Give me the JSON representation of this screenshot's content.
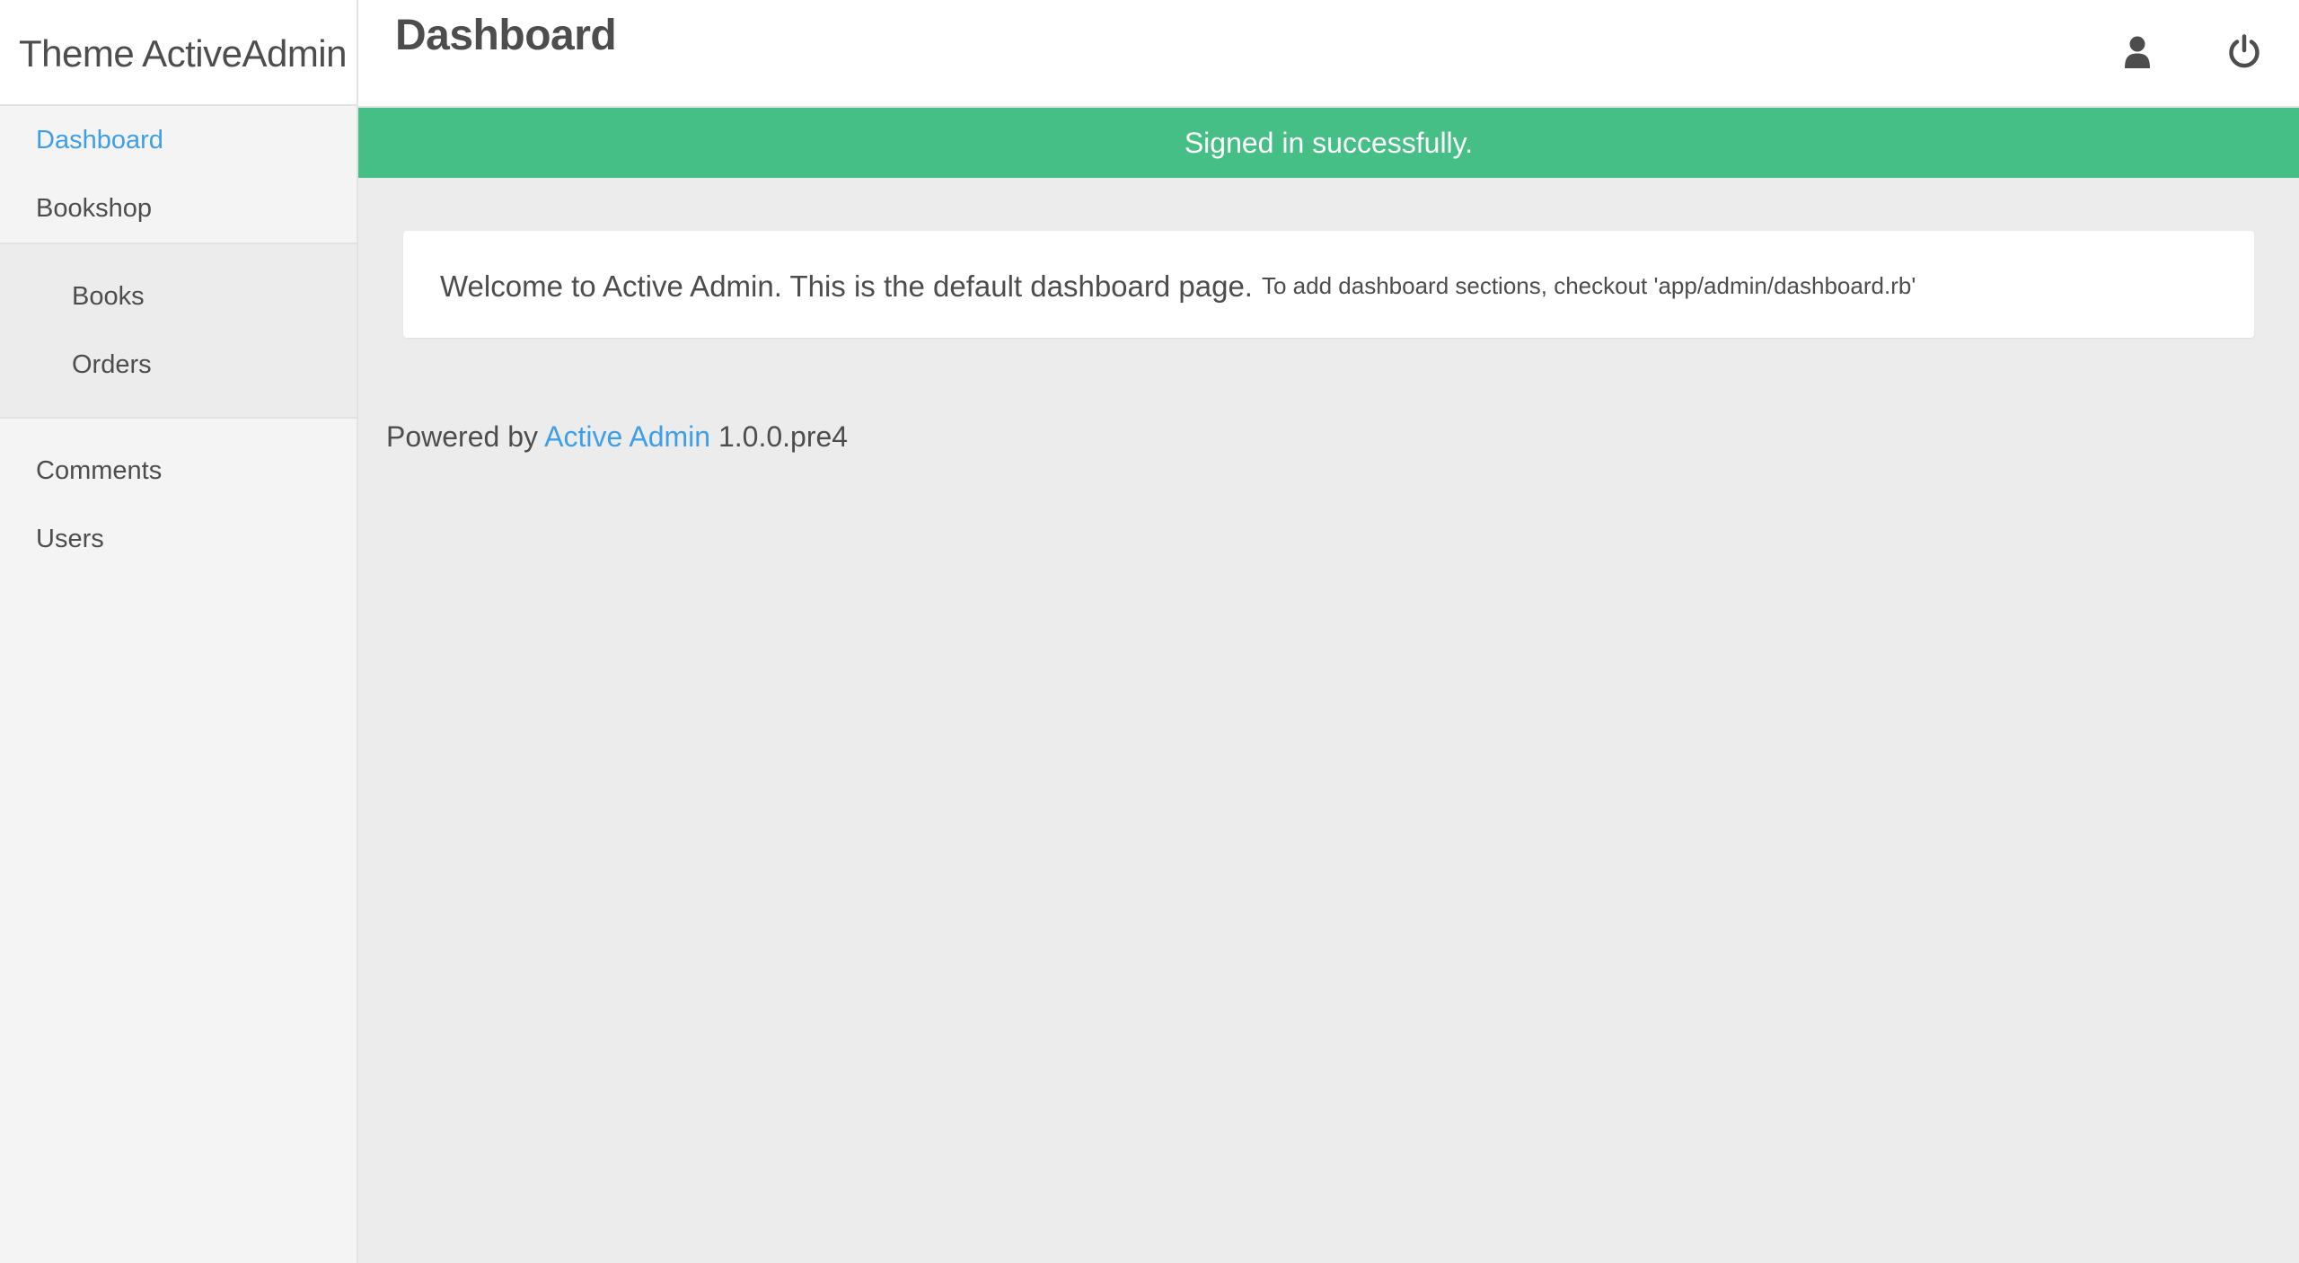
{
  "app": {
    "brand": "Theme ActiveAdmin"
  },
  "header": {
    "title": "Dashboard",
    "icons": [
      "user-icon",
      "power-icon"
    ]
  },
  "sidebar": {
    "items": [
      {
        "label": "Dashboard"
      },
      {
        "label": "Bookshop"
      },
      {
        "label": "Books"
      },
      {
        "label": "Orders"
      },
      {
        "label": "Comments"
      },
      {
        "label": "Users"
      }
    ]
  },
  "flash": {
    "message": "Signed in successfully."
  },
  "main": {
    "welcome": "Welcome to Active Admin. This is the default dashboard page.",
    "hint": "To add dashboard sections, checkout 'app/admin/dashboard.rb'"
  },
  "footer": {
    "prefix": "Powered by",
    "link": "Active Admin",
    "version": "1.0.0.pre4"
  },
  "colors": {
    "accent": "#3f9ee8",
    "success": "#46bf87",
    "background": "#ececec",
    "sidebar": "#f4f4f4"
  }
}
